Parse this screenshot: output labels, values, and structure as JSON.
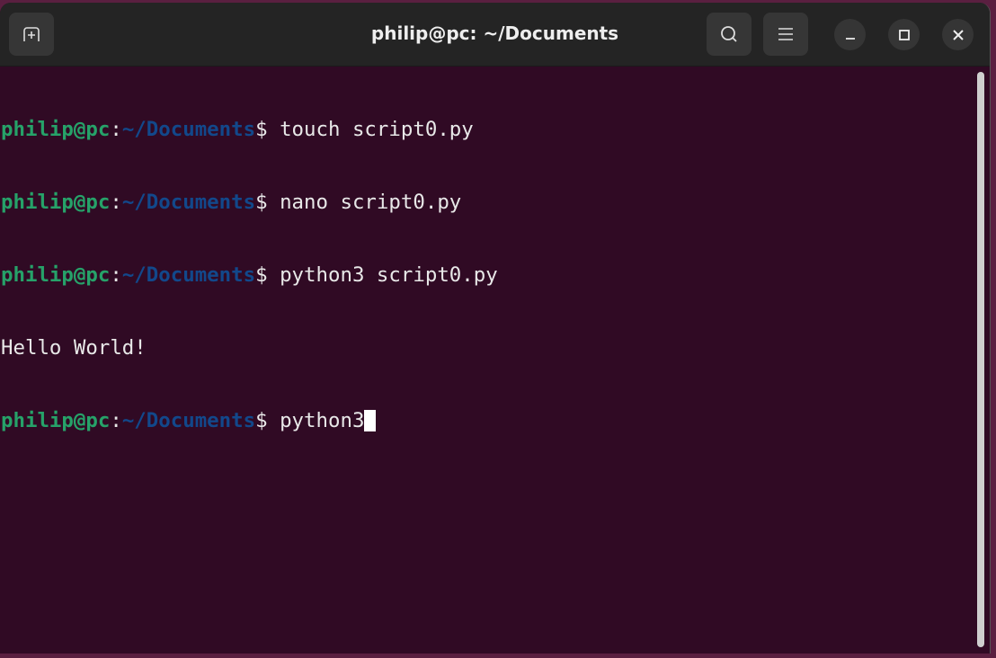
{
  "window": {
    "title": "philip@pc: ~/Documents"
  },
  "header": {
    "new_tab_icon": "new-tab-icon",
    "search_icon": "search-icon",
    "menu_icon": "hamburger-menu-icon"
  },
  "prompt": {
    "user": "philip@pc",
    "sep": ":",
    "path": "~/Documents",
    "symbol": "$"
  },
  "lines": [
    {
      "type": "cmd",
      "text": " touch script0.py"
    },
    {
      "type": "cmd",
      "text": " nano script0.py"
    },
    {
      "type": "cmd",
      "text": " python3 script0.py"
    },
    {
      "type": "out",
      "text": "Hello World!"
    },
    {
      "type": "cmd",
      "text": " python3"
    }
  ],
  "colors": {
    "background": "#300a24",
    "user": "#26a269",
    "path": "#12488b"
  }
}
